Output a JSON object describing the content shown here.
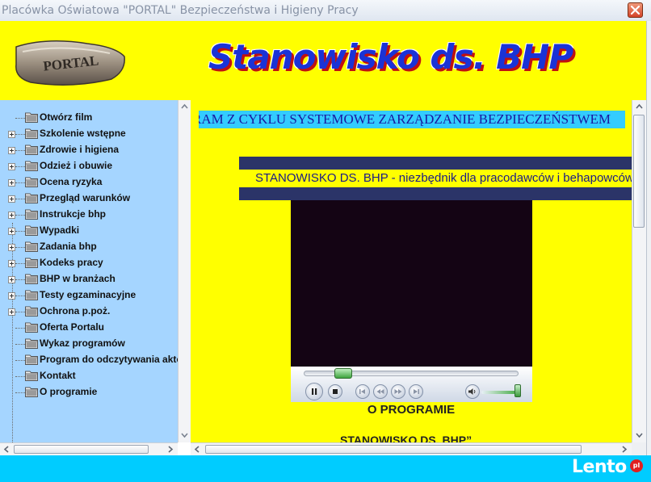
{
  "window": {
    "title": "Placówka Oświatowa \"PORTAL\" Bezpieczeństwa i Higieny Pracy"
  },
  "header": {
    "logo_text": "PORTAL",
    "title": "Stanowisko ds. BHP"
  },
  "sidebar": {
    "items": [
      {
        "label": "Otwórz film",
        "expandable": false
      },
      {
        "label": "Szkolenie wstępne",
        "expandable": true
      },
      {
        "label": "Zdrowie i higiena",
        "expandable": true
      },
      {
        "label": "Odzież i obuwie",
        "expandable": true
      },
      {
        "label": "Ocena ryzyka",
        "expandable": true
      },
      {
        "label": "Przegląd warunków",
        "expandable": true
      },
      {
        "label": "Instrukcje bhp",
        "expandable": true
      },
      {
        "label": "Wypadki",
        "expandable": true
      },
      {
        "label": "Zadania bhp",
        "expandable": true
      },
      {
        "label": "Kodeks pracy",
        "expandable": true
      },
      {
        "label": "BHP w branżach",
        "expandable": true
      },
      {
        "label": "Testy egzaminacyjne",
        "expandable": true
      },
      {
        "label": "Ochrona p.poż.",
        "expandable": true
      },
      {
        "label": "Oferta Portalu",
        "expandable": false
      },
      {
        "label": "Wykaz programów",
        "expandable": false
      },
      {
        "label": "Program do odczytywania aktów",
        "expandable": false
      },
      {
        "label": "Kontakt",
        "expandable": false
      },
      {
        "label": "O programie",
        "expandable": false
      }
    ]
  },
  "main": {
    "marquee_top": "RAM Z CYKLU SYSTEMOWE ZARZĄDZANIE BEZPIECZEŃSTWEM",
    "marquee_banner": "STANOWISKO DS. BHP - niezbędnik dla pracodawców i behapowców",
    "about_heading": "O PROGRAMIE",
    "about_subheading": "STANOWISKO DS. BHP”"
  },
  "player": {
    "state": "playing",
    "progress": 0.2,
    "volume": 0.9
  },
  "footer": {
    "watermark": "Lento",
    "watermark_badge": "pl"
  },
  "colors": {
    "yellow": "#ffff00",
    "sidebar_bg": "#a5d5ff",
    "cyan_footer": "#00ccff",
    "title_blue": "#1a33d6",
    "title_shadow_red": "#c01010",
    "navy_band": "#2b3468"
  }
}
